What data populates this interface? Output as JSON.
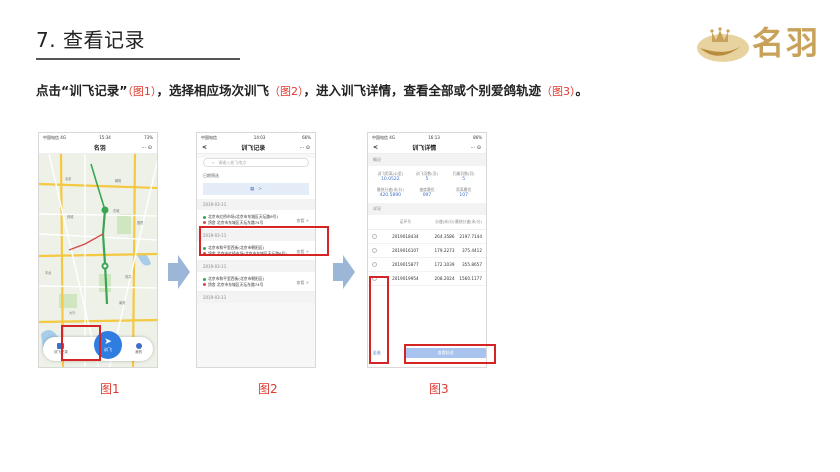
{
  "header": {
    "title": "7. 查看记录",
    "logo_text": "名羽"
  },
  "instruction": {
    "p1": "点击“训飞记录”",
    "fig1": "（图1）",
    "p2": "，选择相应场次训飞",
    "fig2": "（图2）",
    "p3": "，进入训飞详情，查看全部或个别爱鸽轨迹",
    "fig3": "（图3）",
    "p4": "。"
  },
  "phone1": {
    "status": {
      "carrier": "中国电信 4G",
      "time": "15:34",
      "battery": "73%"
    },
    "title": "名羽",
    "controls": "··· ⊙",
    "tabs": {
      "record": "训飞记录",
      "fly": "训飞",
      "mine": "我的"
    }
  },
  "phone2": {
    "status": {
      "carrier": "中国电信",
      "time": "14:03",
      "battery": "66%"
    },
    "back": "<",
    "title": "训飞记录",
    "controls": "··· ⊙",
    "search_placeholder": "请输入放飞地点",
    "filter_label": "日期筛选",
    "cal_suffix": ">",
    "groups": [
      {
        "date": "2019-03-11",
        "start": "北京市红桥市场(北京市东城区天坛路6号)",
        "end": "鸽舍 北京市东城区天坛东路74号",
        "view": "查看 >"
      },
      {
        "date": "2019-03-11",
        "start": "北京市和平里西街(北京市朝阳区)",
        "end": "鸽舍 北京市红桥市场(北京市东城区天坛路6号)",
        "view": "查看 >"
      },
      {
        "date": "2019-03-11",
        "start": "北京市和平里西街(北京市朝阳区)",
        "end": "鸽舍 北京市东城区天坛东路74号",
        "view": "查看 >"
      },
      {
        "date": "2019-03-11"
      }
    ]
  },
  "phone3": {
    "status": {
      "carrier": "中国电信 4G",
      "time": "16:13",
      "battery": "86%"
    },
    "back": "<",
    "title": "训飞详情",
    "controls": "··· ⊙",
    "overview_label": "概况",
    "stats": [
      {
        "label": "训飞距离(公里)",
        "value": "10.0522"
      },
      {
        "label": "训飞羽数(羽)",
        "value": "5"
      },
      {
        "label": "归巢羽数(羽)",
        "value": "5"
      },
      {
        "label": "最快分速(米/分)",
        "value": "420.5890"
      },
      {
        "label": "速度最优",
        "value": "097"
      },
      {
        "label": "距离最优",
        "value": "107"
      }
    ],
    "detail_label": "详况",
    "columns": [
      "足环号",
      "分速(米/分)",
      "最快分速(米/分)"
    ],
    "rows": [
      {
        "ring": "2019018434",
        "speed": "264.3586",
        "max": "2197.7144"
      },
      {
        "ring": "2019016107",
        "speed": "179.2273",
        "max": "375.4412"
      },
      {
        "ring": "2019015877",
        "speed": "172.1039",
        "max": "355.8657"
      },
      {
        "ring": "2019019954",
        "speed": "208.2024",
        "max": "1560.1177"
      }
    ],
    "all_label": "全选",
    "view_button": "查看轨迹"
  },
  "captions": {
    "fig1": "图1",
    "fig2": "图2",
    "fig3": "图3"
  },
  "colors": {
    "accent_red": "#e03a2f",
    "highlight": "#d42424",
    "app_blue": "#2f7de1",
    "logo_gold": "#c9a25a"
  }
}
